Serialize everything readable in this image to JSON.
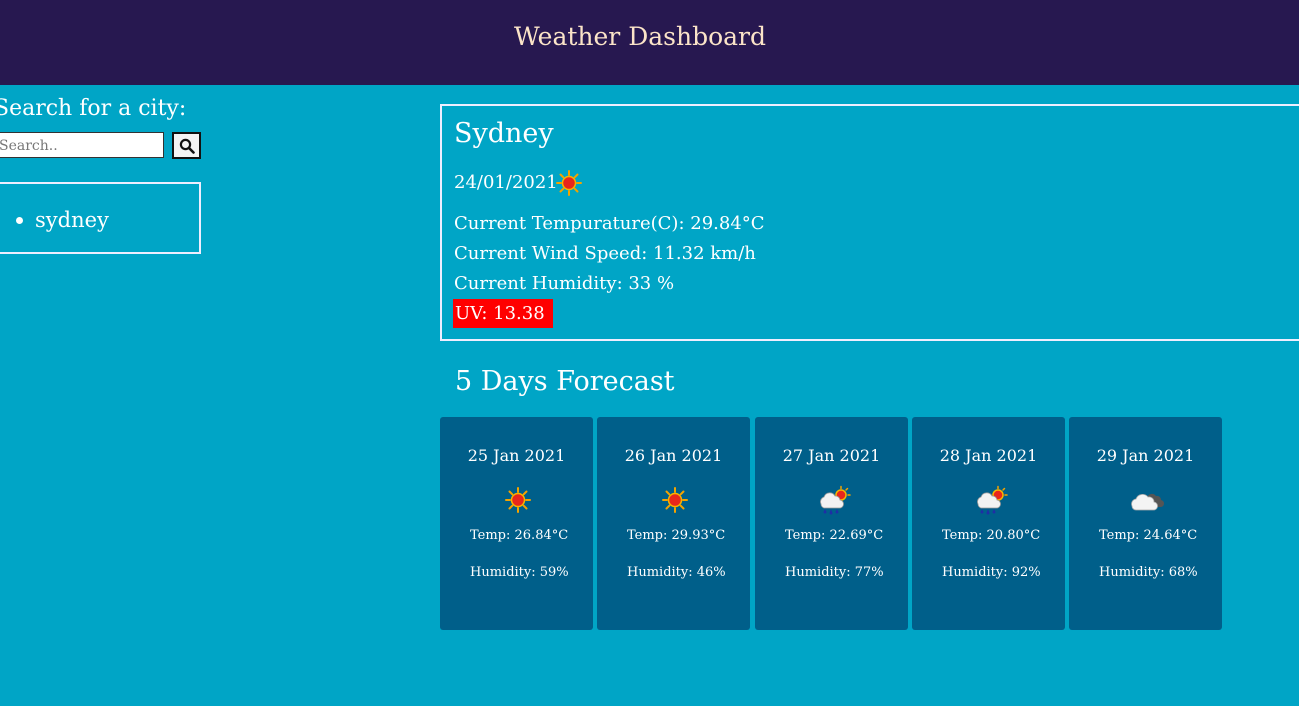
{
  "header": {
    "title": "Weather Dashboard"
  },
  "search": {
    "label": "Search for a city:",
    "placeholder": "Search..",
    "button_icon": "search-icon"
  },
  "history": {
    "items": [
      {
        "label": "sydney"
      }
    ]
  },
  "current": {
    "city": "Sydney",
    "date": "24/01/2021",
    "icon": "sun-icon",
    "temperature": "Current Tempurature(C): 29.84°C",
    "wind": "Current Wind Speed: 11.32 km/h",
    "humidity": "Current Humidity: 33 %",
    "uv": "UV: 13.38",
    "uv_color": "#ff0000"
  },
  "forecast": {
    "heading": "5 Days Forecast",
    "days": [
      {
        "date": "25 Jan 2021",
        "icon": "sun-icon",
        "temp": "Temp: 26.84°C",
        "humidity": "Humidity: 59%"
      },
      {
        "date": "26 Jan 2021",
        "icon": "sun-icon",
        "temp": "Temp: 29.93°C",
        "humidity": "Humidity: 46%"
      },
      {
        "date": "27 Jan 2021",
        "icon": "rain-sun-icon",
        "temp": "Temp: 22.69°C",
        "humidity": "Humidity: 77%"
      },
      {
        "date": "28 Jan 2021",
        "icon": "rain-sun-icon",
        "temp": "Temp: 20.80°C",
        "humidity": "Humidity: 92%"
      },
      {
        "date": "29 Jan 2021",
        "icon": "cloud-icon",
        "temp": "Temp: 24.64°C",
        "humidity": "Humidity: 68%"
      }
    ]
  },
  "colors": {
    "background": "#00a5c6",
    "header": "#271850",
    "card": "#005f8a",
    "title_text": "#fbe4c8"
  }
}
